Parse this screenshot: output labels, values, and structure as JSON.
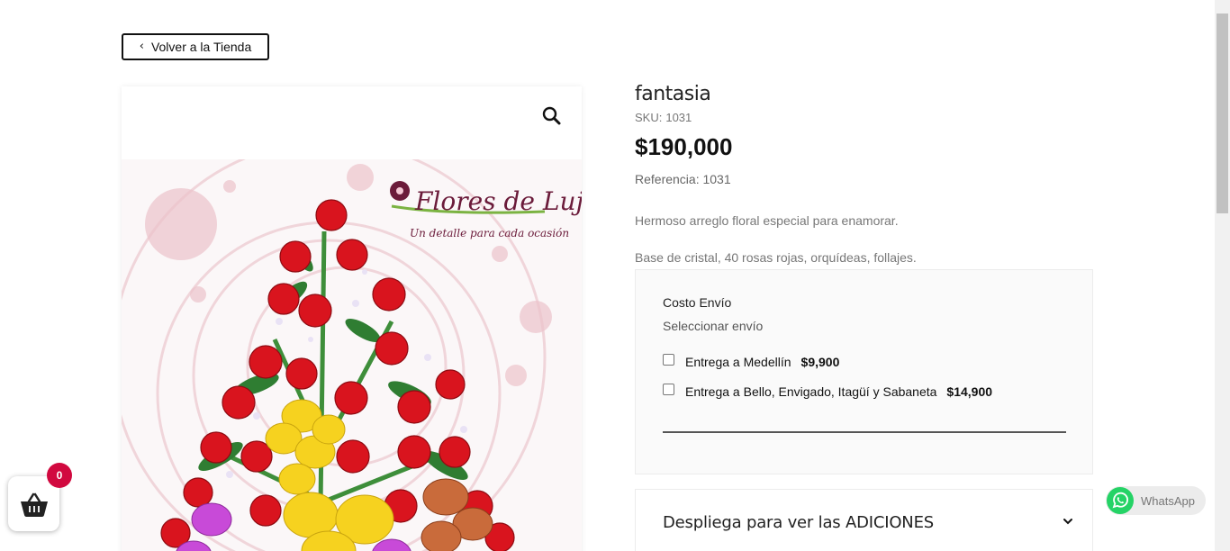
{
  "nav": {
    "back_label": "Volver a la Tienda"
  },
  "product": {
    "title": "fantasia",
    "sku_label": "SKU:",
    "sku_value": "1031",
    "price": "$190,000",
    "reference": "Referencia: 1031",
    "description_1": "Hermoso arreglo floral especial para enamorar.",
    "description_2": "Base de cristal, 40 rosas rojas, orquídeas, follajes."
  },
  "logo": {
    "name": "Flores de Lujo",
    "tagline": "Un detalle para cada ocasión"
  },
  "shipping": {
    "title": "Costo Envío",
    "subtitle": "Seleccionar envío",
    "options": [
      {
        "label": "Entrega a Medellín",
        "price": "$9,900",
        "checked": false
      },
      {
        "label": "Entrega a Bello, Envigado, Itagüí y Sabaneta",
        "price": "$14,900",
        "checked": false
      }
    ]
  },
  "addons": {
    "label": "Despliega para ver las ADICIONES"
  },
  "cart": {
    "count": "0"
  },
  "whatsapp": {
    "label": "WhatsApp"
  },
  "colors": {
    "badge": "#d1093f",
    "whatsapp_green": "#25d366",
    "price": "#111111"
  }
}
